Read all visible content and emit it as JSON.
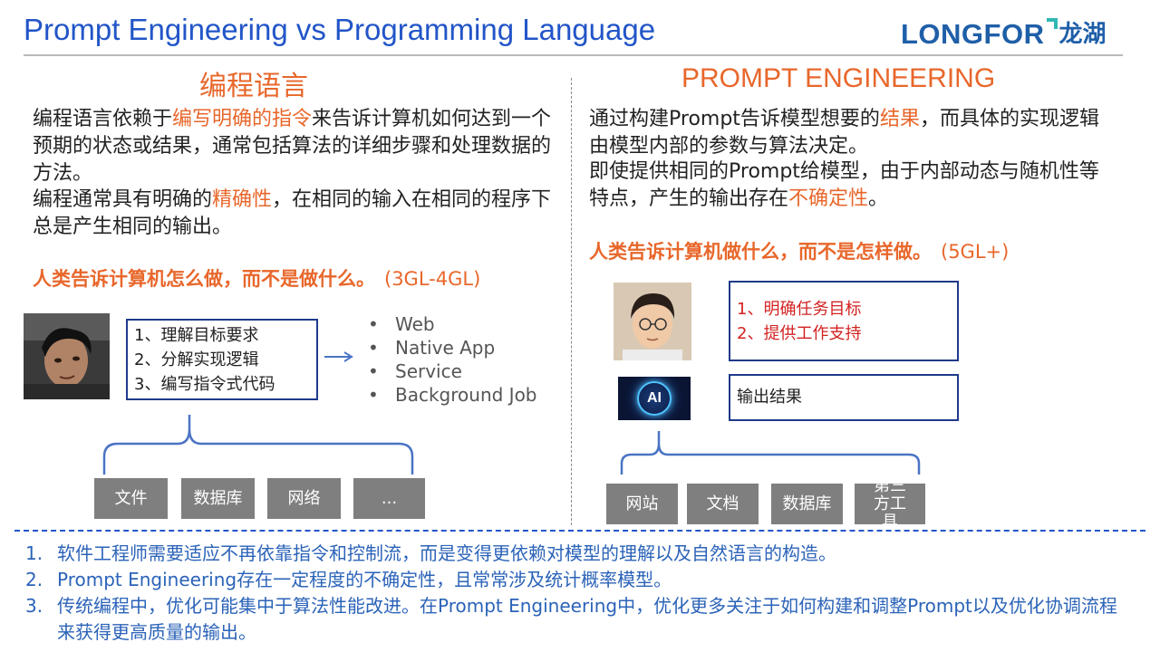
{
  "header": {
    "title": "Prompt Engineering vs Programming Language",
    "logo_en": "LONGFOR",
    "logo_cn": "龙湖"
  },
  "left": {
    "heading": "编程语言",
    "para1_pre": "编程语言依赖于",
    "para1_hl": "编写明确的指令",
    "para1_post": "来告诉计算机如何达到一个预期的状态或结果，通常包括算法的详细步骤和处理数据的方法。",
    "para2_pre": "编程通常具有明确的",
    "para2_hl": "精确性",
    "para2_post": "，在相同的输入在相同的程序下总是产生相同的输出。",
    "slogan": "人类告诉计算机怎么做，而不是做什么。",
    "level": "(3GL-4GL)",
    "steps": [
      "1、理解目标要求",
      "2、分解实现逻辑",
      "3、编写指令式代码"
    ],
    "outputs": [
      "Web",
      "Native App",
      "Service",
      "Background Job"
    ],
    "resources": [
      "文件",
      "数据库",
      "网络",
      "..."
    ]
  },
  "right": {
    "heading": "PROMPT ENGINEERING",
    "para1_pre": "通过构建Prompt告诉模型想要的",
    "para1_hl": "结果",
    "para1_post": "，而具体的实现逻辑由模型内部的参数与算法决定。",
    "para2_pre": "即使提供相同的Prompt给模型，由于内部动态与随机性等特点，产生的输出存在",
    "para2_hl": "不确定性",
    "para2_post": "。",
    "slogan": "人类告诉计算机做什么，而不是怎样做。",
    "level": "(5GL+)",
    "tasks": [
      "1、明确任务目标",
      "2、提供工作支持"
    ],
    "ai_label": "AI",
    "output_box": "输出结果",
    "resources": [
      "网站",
      "文档",
      "数据库",
      "第三方工具"
    ]
  },
  "notes": [
    {
      "num": "1.",
      "text": "软件工程师需要适应不再依靠指令和控制流，而是变得更依赖对模型的理解以及自然语言的构造。"
    },
    {
      "num": "2.",
      "text": "Prompt Engineering存在一定程度的不确定性，且常常涉及统计概率模型。"
    },
    {
      "num": "3.",
      "text": "传统编程中，优化可能集中于算法性能改进。在Prompt Engineering中，优化更多关注于如何构建和调整Prompt以及优化协调流程来获得更高质量的输出。"
    }
  ],
  "colors": {
    "title_blue": "#2255c8",
    "accent_orange": "#e8672b",
    "box_border": "#1f3a8a",
    "gray_box": "#7f7f7f",
    "brace_blue": "#4a74c4"
  }
}
